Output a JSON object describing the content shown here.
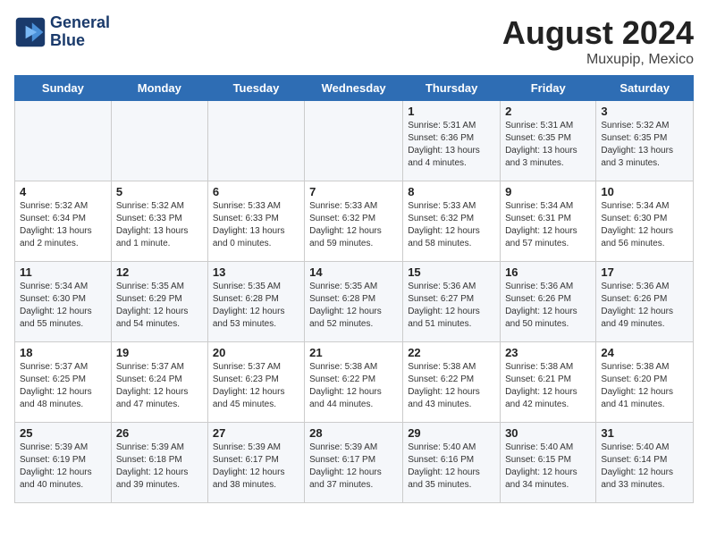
{
  "header": {
    "logo_line1": "General",
    "logo_line2": "Blue",
    "title": "August 2024",
    "subtitle": "Muxupip, Mexico"
  },
  "days_of_week": [
    "Sunday",
    "Monday",
    "Tuesday",
    "Wednesday",
    "Thursday",
    "Friday",
    "Saturday"
  ],
  "weeks": [
    [
      {
        "day": "",
        "info": ""
      },
      {
        "day": "",
        "info": ""
      },
      {
        "day": "",
        "info": ""
      },
      {
        "day": "",
        "info": ""
      },
      {
        "day": "1",
        "info": "Sunrise: 5:31 AM\nSunset: 6:36 PM\nDaylight: 13 hours\nand 4 minutes."
      },
      {
        "day": "2",
        "info": "Sunrise: 5:31 AM\nSunset: 6:35 PM\nDaylight: 13 hours\nand 3 minutes."
      },
      {
        "day": "3",
        "info": "Sunrise: 5:32 AM\nSunset: 6:35 PM\nDaylight: 13 hours\nand 3 minutes."
      }
    ],
    [
      {
        "day": "4",
        "info": "Sunrise: 5:32 AM\nSunset: 6:34 PM\nDaylight: 13 hours\nand 2 minutes."
      },
      {
        "day": "5",
        "info": "Sunrise: 5:32 AM\nSunset: 6:33 PM\nDaylight: 13 hours\nand 1 minute."
      },
      {
        "day": "6",
        "info": "Sunrise: 5:33 AM\nSunset: 6:33 PM\nDaylight: 13 hours\nand 0 minutes."
      },
      {
        "day": "7",
        "info": "Sunrise: 5:33 AM\nSunset: 6:32 PM\nDaylight: 12 hours\nand 59 minutes."
      },
      {
        "day": "8",
        "info": "Sunrise: 5:33 AM\nSunset: 6:32 PM\nDaylight: 12 hours\nand 58 minutes."
      },
      {
        "day": "9",
        "info": "Sunrise: 5:34 AM\nSunset: 6:31 PM\nDaylight: 12 hours\nand 57 minutes."
      },
      {
        "day": "10",
        "info": "Sunrise: 5:34 AM\nSunset: 6:30 PM\nDaylight: 12 hours\nand 56 minutes."
      }
    ],
    [
      {
        "day": "11",
        "info": "Sunrise: 5:34 AM\nSunset: 6:30 PM\nDaylight: 12 hours\nand 55 minutes."
      },
      {
        "day": "12",
        "info": "Sunrise: 5:35 AM\nSunset: 6:29 PM\nDaylight: 12 hours\nand 54 minutes."
      },
      {
        "day": "13",
        "info": "Sunrise: 5:35 AM\nSunset: 6:28 PM\nDaylight: 12 hours\nand 53 minutes."
      },
      {
        "day": "14",
        "info": "Sunrise: 5:35 AM\nSunset: 6:28 PM\nDaylight: 12 hours\nand 52 minutes."
      },
      {
        "day": "15",
        "info": "Sunrise: 5:36 AM\nSunset: 6:27 PM\nDaylight: 12 hours\nand 51 minutes."
      },
      {
        "day": "16",
        "info": "Sunrise: 5:36 AM\nSunset: 6:26 PM\nDaylight: 12 hours\nand 50 minutes."
      },
      {
        "day": "17",
        "info": "Sunrise: 5:36 AM\nSunset: 6:26 PM\nDaylight: 12 hours\nand 49 minutes."
      }
    ],
    [
      {
        "day": "18",
        "info": "Sunrise: 5:37 AM\nSunset: 6:25 PM\nDaylight: 12 hours\nand 48 minutes."
      },
      {
        "day": "19",
        "info": "Sunrise: 5:37 AM\nSunset: 6:24 PM\nDaylight: 12 hours\nand 47 minutes."
      },
      {
        "day": "20",
        "info": "Sunrise: 5:37 AM\nSunset: 6:23 PM\nDaylight: 12 hours\nand 45 minutes."
      },
      {
        "day": "21",
        "info": "Sunrise: 5:38 AM\nSunset: 6:22 PM\nDaylight: 12 hours\nand 44 minutes."
      },
      {
        "day": "22",
        "info": "Sunrise: 5:38 AM\nSunset: 6:22 PM\nDaylight: 12 hours\nand 43 minutes."
      },
      {
        "day": "23",
        "info": "Sunrise: 5:38 AM\nSunset: 6:21 PM\nDaylight: 12 hours\nand 42 minutes."
      },
      {
        "day": "24",
        "info": "Sunrise: 5:38 AM\nSunset: 6:20 PM\nDaylight: 12 hours\nand 41 minutes."
      }
    ],
    [
      {
        "day": "25",
        "info": "Sunrise: 5:39 AM\nSunset: 6:19 PM\nDaylight: 12 hours\nand 40 minutes."
      },
      {
        "day": "26",
        "info": "Sunrise: 5:39 AM\nSunset: 6:18 PM\nDaylight: 12 hours\nand 39 minutes."
      },
      {
        "day": "27",
        "info": "Sunrise: 5:39 AM\nSunset: 6:17 PM\nDaylight: 12 hours\nand 38 minutes."
      },
      {
        "day": "28",
        "info": "Sunrise: 5:39 AM\nSunset: 6:17 PM\nDaylight: 12 hours\nand 37 minutes."
      },
      {
        "day": "29",
        "info": "Sunrise: 5:40 AM\nSunset: 6:16 PM\nDaylight: 12 hours\nand 35 minutes."
      },
      {
        "day": "30",
        "info": "Sunrise: 5:40 AM\nSunset: 6:15 PM\nDaylight: 12 hours\nand 34 minutes."
      },
      {
        "day": "31",
        "info": "Sunrise: 5:40 AM\nSunset: 6:14 PM\nDaylight: 12 hours\nand 33 minutes."
      }
    ]
  ]
}
